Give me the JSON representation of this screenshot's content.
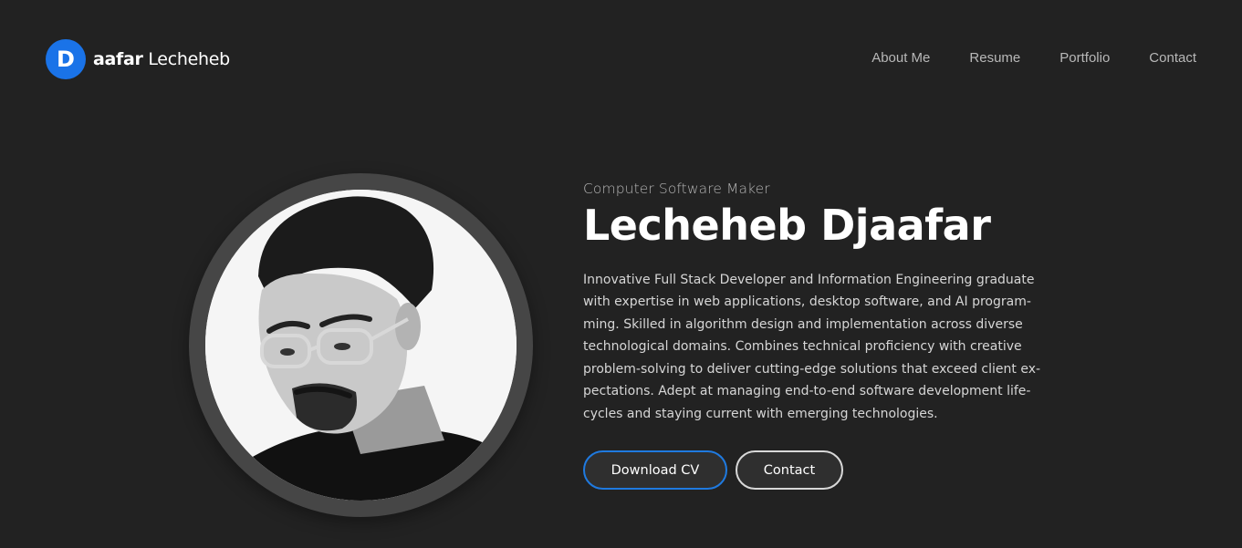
{
  "header": {
    "logo_letter": "D",
    "logo_bold": "aafar",
    "logo_rest": " Lecheheb",
    "nav": [
      {
        "label": "About Me"
      },
      {
        "label": "Resume"
      },
      {
        "label": "Portfolio"
      },
      {
        "label": "Contact"
      }
    ]
  },
  "hero": {
    "subtitle": "Computer Software Maker",
    "name": "Lecheheb Djaafar",
    "bio": "Innovative Full Stack Developer and Information Engineering graduate with expertise in web applications, desktop software, and AI program-ming. Skilled in algorithm design and implementation across diverse technological domains. Combines technical proficiency with creative problem-solving to deliver cutting-edge solutions that exceed client ex-pectations. Adept at managing end-to-end software development life-cycles and staying current with emerging technologies.",
    "primary_button": "Download CV",
    "secondary_button": "Contact"
  },
  "colors": {
    "background": "#222222",
    "accent": "#1a73e8",
    "ring": "#464646"
  },
  "icons": {
    "logo": "letter-d-circle-icon"
  }
}
